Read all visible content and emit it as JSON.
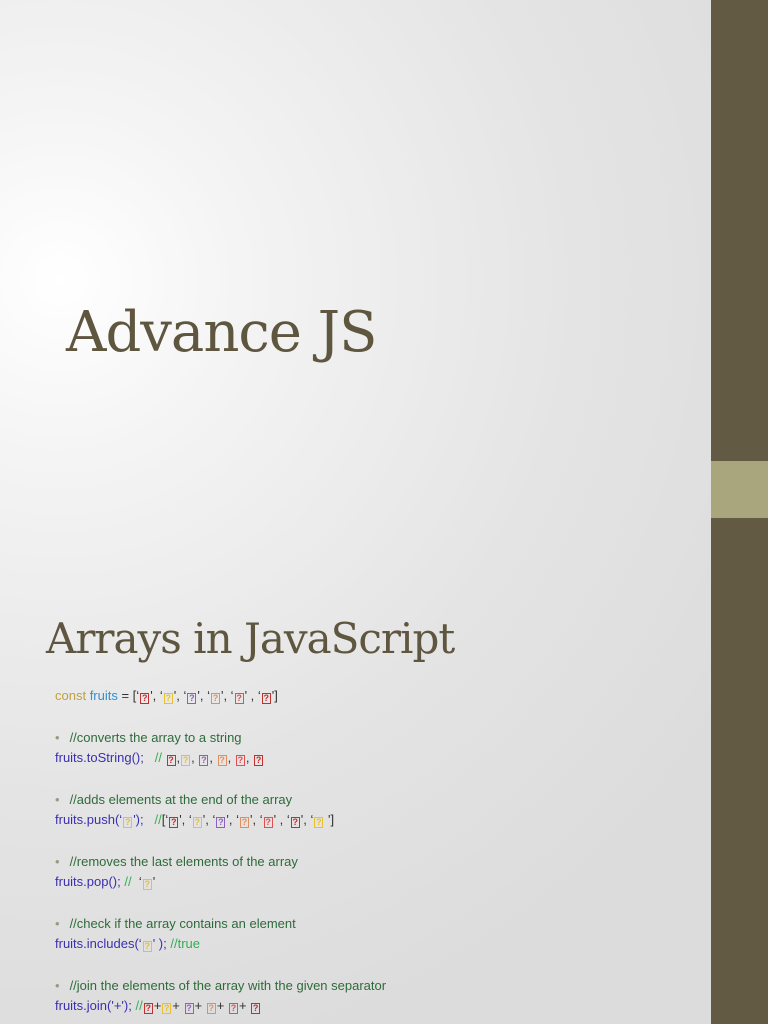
{
  "title": "Advance JS",
  "section_title": "Arrays in JavaScript",
  "colors": {
    "band": "#635a44",
    "accent": "#a9a67e",
    "keyword": "#c0a040",
    "var": "#3090d0",
    "code": "#3a2fb0",
    "comment": "#2e6b3a",
    "comment_bright": "#30b050",
    "plain": "#333333",
    "r": "#c03030",
    "y": "#e8c030",
    "p": "#9060c0",
    "o": "#e09060",
    "s": "#e05050"
  },
  "lines": [
    {
      "bullet": false,
      "segs": [
        {
          "t": "const ",
          "c": "keyword"
        },
        {
          "t": "fruits",
          "c": "var"
        },
        {
          "t": " = [‘",
          "c": "plain"
        },
        {
          "t": "?",
          "c": "r",
          "box": true
        },
        {
          "t": "', ‘",
          "c": "plain"
        },
        {
          "t": "?",
          "c": "y",
          "box": true
        },
        {
          "t": "', ‘",
          "c": "plain"
        },
        {
          "t": "?",
          "c": "p",
          "box": true
        },
        {
          "t": "', ‘",
          "c": "plain"
        },
        {
          "t": "?",
          "c": "o",
          "box": true
        },
        {
          "t": "', ‘",
          "c": "plain"
        },
        {
          "t": "?",
          "c": "s",
          "box": true
        },
        {
          "t": "' , ‘",
          "c": "plain"
        },
        {
          "t": "?",
          "c": "r",
          "box": true
        },
        {
          "t": "']",
          "c": "plain"
        }
      ]
    },
    {
      "gap": true
    },
    {
      "bullet": true,
      "segs": [
        {
          "t": "//converts the array to a string",
          "c": "comment"
        }
      ]
    },
    {
      "bullet": false,
      "segs": [
        {
          "t": "fruits.toString();   ",
          "c": "code"
        },
        {
          "t": "// ",
          "c": "comment_bright"
        },
        {
          "t": "?",
          "c": "r",
          "box": true
        },
        {
          "t": ",",
          "c": "plain"
        },
        {
          "t": "?",
          "c": "y",
          "box": true
        },
        {
          "t": ", ",
          "c": "plain"
        },
        {
          "t": "?",
          "c": "p",
          "box": true
        },
        {
          "t": ", ",
          "c": "plain"
        },
        {
          "t": "?",
          "c": "o",
          "box": true
        },
        {
          "t": ", ",
          "c": "plain"
        },
        {
          "t": "?",
          "c": "s",
          "box": true
        },
        {
          "t": ", ",
          "c": "plain"
        },
        {
          "t": "?",
          "c": "r",
          "box": true
        }
      ]
    },
    {
      "gap": true
    },
    {
      "bullet": true,
      "segs": [
        {
          "t": "//adds elements at the end of the array",
          "c": "comment"
        }
      ]
    },
    {
      "bullet": false,
      "segs": [
        {
          "t": "fruits.push(‘",
          "c": "code"
        },
        {
          "t": "?",
          "c": "y",
          "box": true
        },
        {
          "t": "');   ",
          "c": "code"
        },
        {
          "t": "//",
          "c": "comment_bright"
        },
        {
          "t": "[‘",
          "c": "plain"
        },
        {
          "t": "?",
          "c": "r",
          "box": true
        },
        {
          "t": "', ‘",
          "c": "plain"
        },
        {
          "t": "?",
          "c": "y",
          "box": true
        },
        {
          "t": "', ‘",
          "c": "plain"
        },
        {
          "t": "?",
          "c": "p",
          "box": true
        },
        {
          "t": "', ‘",
          "c": "plain"
        },
        {
          "t": "?",
          "c": "o",
          "box": true
        },
        {
          "t": "', ‘",
          "c": "plain"
        },
        {
          "t": "?",
          "c": "s",
          "box": true
        },
        {
          "t": "' , ‘",
          "c": "plain"
        },
        {
          "t": "?",
          "c": "r",
          "box": true
        },
        {
          "t": "', ‘",
          "c": "plain"
        },
        {
          "t": "?",
          "c": "y",
          "box": true
        },
        {
          "t": " ']",
          "c": "plain"
        }
      ]
    },
    {
      "gap": true
    },
    {
      "bullet": true,
      "segs": [
        {
          "t": "//removes the last elements of the array",
          "c": "comment"
        }
      ]
    },
    {
      "bullet": false,
      "segs": [
        {
          "t": "fruits.pop(); ",
          "c": "code"
        },
        {
          "t": "//  ",
          "c": "comment_bright"
        },
        {
          "t": "‘",
          "c": "plain"
        },
        {
          "t": "?",
          "c": "y",
          "box": true
        },
        {
          "t": "'",
          "c": "plain"
        }
      ]
    },
    {
      "gap": true
    },
    {
      "bullet": true,
      "segs": [
        {
          "t": "//check if the array contains an element",
          "c": "comment"
        }
      ]
    },
    {
      "bullet": false,
      "segs": [
        {
          "t": "fruits.includes(‘",
          "c": "code"
        },
        {
          "t": "?",
          "c": "y",
          "box": true
        },
        {
          "t": "' ); ",
          "c": "code"
        },
        {
          "t": "//true",
          "c": "comment_bright"
        }
      ]
    },
    {
      "gap": true
    },
    {
      "bullet": true,
      "segs": [
        {
          "t": "//join the elements of the array with the given separator",
          "c": "comment"
        }
      ]
    },
    {
      "bullet": false,
      "segs": [
        {
          "t": "fruits.join('+'); ",
          "c": "code"
        },
        {
          "t": "//",
          "c": "comment_bright"
        },
        {
          "t": "?",
          "c": "r",
          "box": true
        },
        {
          "t": "+",
          "c": "plain"
        },
        {
          "t": "?",
          "c": "y",
          "box": true
        },
        {
          "t": "+ ",
          "c": "plain"
        },
        {
          "t": "?",
          "c": "p",
          "box": true
        },
        {
          "t": "+ ",
          "c": "plain"
        },
        {
          "t": "?",
          "c": "o",
          "box": true
        },
        {
          "t": "+ ",
          "c": "plain"
        },
        {
          "t": "?",
          "c": "s",
          "box": true
        },
        {
          "t": "+ ",
          "c": "plain"
        },
        {
          "t": "?",
          "c": "r",
          "box": true
        }
      ]
    }
  ]
}
